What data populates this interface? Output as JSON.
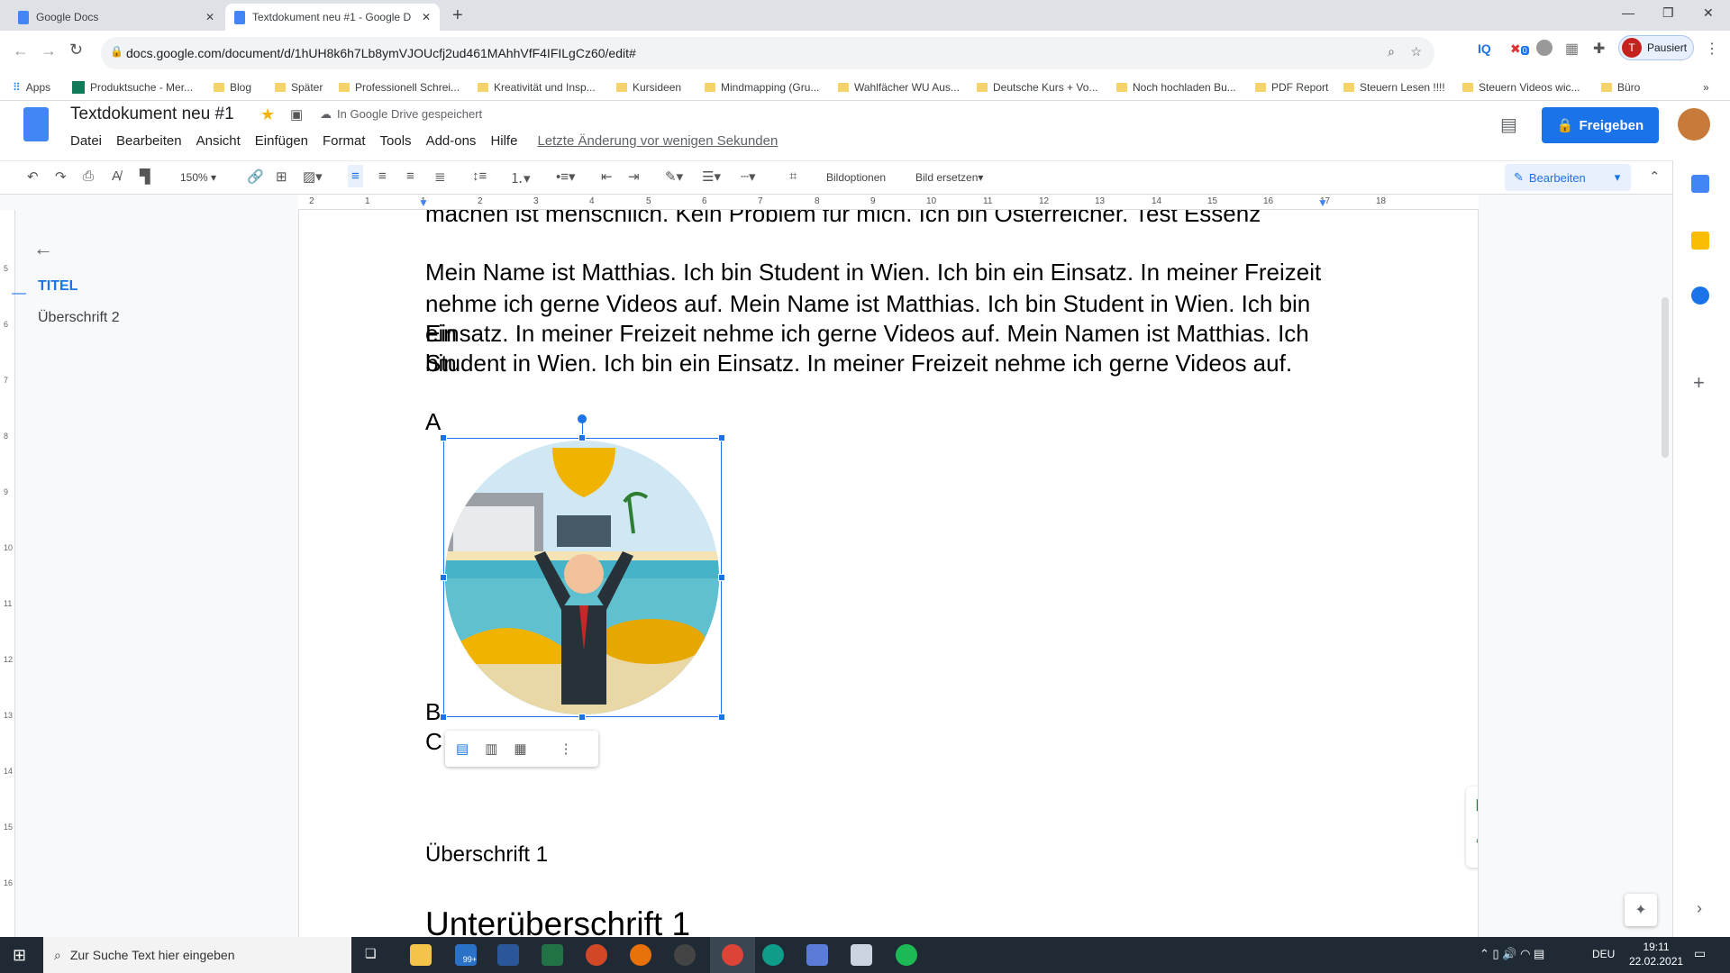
{
  "browser": {
    "tabs": [
      {
        "title": "Google Docs",
        "active": false
      },
      {
        "title": "Textdokument neu #1 - Google D",
        "active": true
      }
    ],
    "new_tab": "+",
    "url": "docs.google.com/document/d/1hUH8k6h7Lb8ymVJOUcfj2ud461MAhhVfF4IFILgCz60/edit#",
    "profile": "Pausiert",
    "profile_initial": "T",
    "extension_badge": "0",
    "bookmarks": [
      "Apps",
      "Produktsuche - Mer...",
      "Blog",
      "Später",
      "Professionell Schrei...",
      "Kreativität und Insp...",
      "Kursideen",
      "Mindmapping (Gru...",
      "Wahlfächer WU Aus...",
      "Deutsche Kurs + Vo...",
      "Noch hochladen Bu...",
      "PDF Report",
      "Steuern Lesen !!!!",
      "Steuern Videos wic...",
      "Büro"
    ],
    "more": "»"
  },
  "docs": {
    "title": "Textdokument neu #1",
    "save_status": "In Google Drive gespeichert",
    "menu": [
      "Datei",
      "Bearbeiten",
      "Ansicht",
      "Einfügen",
      "Format",
      "Tools",
      "Add-ons",
      "Hilfe"
    ],
    "last_edit": "Letzte Änderung vor wenigen Sekunden",
    "share": "Freigeben",
    "toolbar": {
      "zoom": "150%",
      "image_options": "Bildoptionen",
      "replace_image": "Bild ersetzen",
      "mode": "Bearbeiten"
    },
    "ruler": [
      "2",
      "1",
      "1",
      "2",
      "3",
      "4",
      "5",
      "6",
      "7",
      "8",
      "9",
      "10",
      "11",
      "12",
      "13",
      "14",
      "15",
      "16",
      "17",
      "18"
    ],
    "vruler": [
      "5",
      "6",
      "7",
      "8",
      "9",
      "10",
      "11",
      "12",
      "13",
      "14",
      "15",
      "16"
    ],
    "outline": {
      "items": [
        "TITEL",
        "Überschrift 2"
      ]
    },
    "body": {
      "line_top": "machen ist menschlich. Kein Problem für mich. Ich bin Österreicher. Test Essenz",
      "paragraph": [
        "Mein Name ist Matthias. Ich bin Student in Wien. Ich bin ein Einsatz. In meiner Freizeit",
        "nehme ich gerne Videos auf. Mein Name ist Matthias. Ich bin Student in Wien. Ich bin ein",
        "Einsatz. In meiner Freizeit nehme ich gerne Videos auf. Mein Namen ist Matthias. Ich bin",
        "Student in Wien. Ich bin ein Einsatz. In meiner Freizeit nehme ich gerne Videos auf."
      ],
      "label_a": "A",
      "label_b": "B",
      "label_c": "C",
      "heading1": "Überschrift 1",
      "subheading1": "Unterüberschrift 1"
    },
    "accent": "#1a73e8"
  },
  "taskbar": {
    "search_placeholder": "Zur Suche Text hier eingeben",
    "mail_badge": "99+",
    "lang": "DEU",
    "time": "19:11",
    "date": "22.02.2021"
  }
}
